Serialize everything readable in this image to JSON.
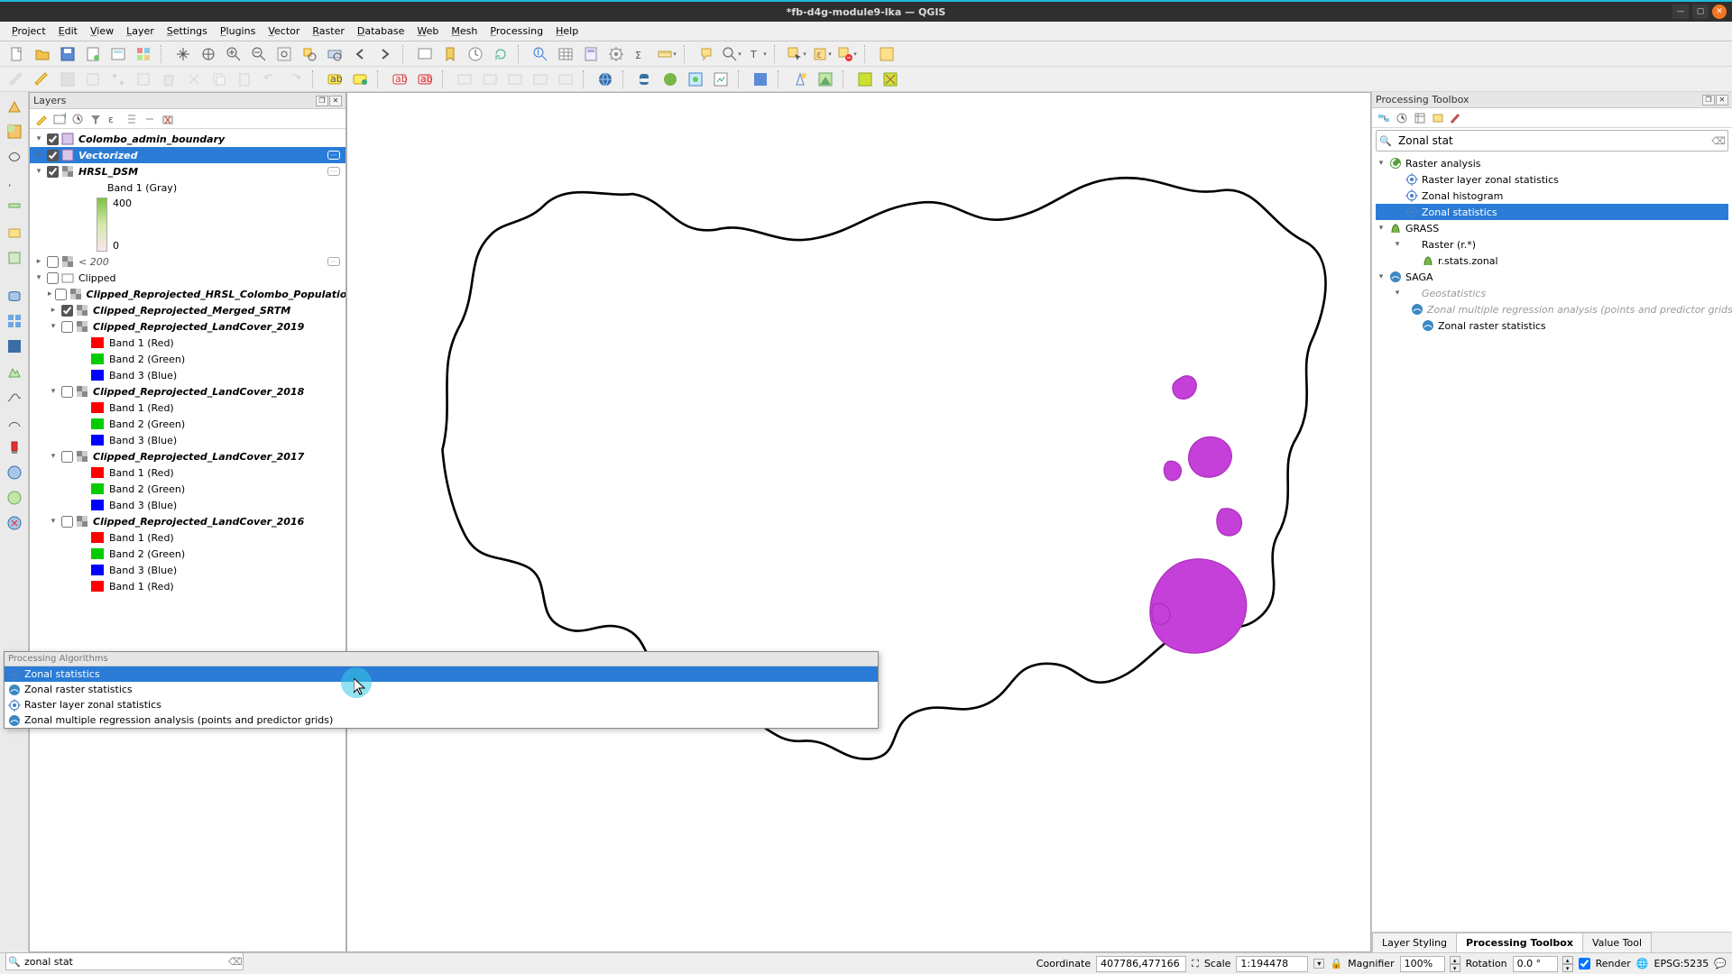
{
  "window": {
    "title": "*fb-d4g-module9-lka — QGIS"
  },
  "menus": [
    "Project",
    "Edit",
    "View",
    "Layer",
    "Settings",
    "Plugins",
    "Vector",
    "Raster",
    "Database",
    "Web",
    "Mesh",
    "Processing",
    "Help"
  ],
  "panels": {
    "layers_title": "Layers",
    "toolbox_title": "Processing Toolbox"
  },
  "layers": {
    "items": [
      {
        "name": "Colombo_admin_boundary",
        "style": "bi",
        "checked": true,
        "indent": 0,
        "exp": "▾",
        "icon": "poly"
      },
      {
        "name": "Vectorized",
        "style": "bi",
        "checked": true,
        "indent": 0,
        "exp": "▸",
        "icon": "poly",
        "selected": true
      },
      {
        "name": "HRSL_DSM",
        "style": "bi",
        "checked": true,
        "indent": 0,
        "exp": "▾",
        "icon": "raster"
      },
      {
        "name": "Band 1 (Gray)",
        "style": "",
        "indent": 2,
        "plain": true
      },
      {
        "name": "< 200",
        "style": "it",
        "checked": false,
        "indent": 0,
        "exp": "▸",
        "icon": "raster"
      },
      {
        "name": "Clipped",
        "style": "",
        "checked": false,
        "indent": 0,
        "exp": "▾",
        "icon": "group"
      },
      {
        "name": "Clipped_Reprojected_HRSL_Colombo_Population",
        "style": "bi",
        "checked": false,
        "indent": 1,
        "exp": "▸",
        "icon": "raster"
      },
      {
        "name": "Clipped_Reprojected_Merged_SRTM",
        "style": "bi",
        "checked": true,
        "indent": 1,
        "exp": "▸",
        "icon": "raster"
      },
      {
        "name": "Clipped_Reprojected_LandCover_2019",
        "style": "bi",
        "checked": false,
        "indent": 1,
        "exp": "▾",
        "icon": "raster"
      },
      {
        "name": "Clipped_Reprojected_LandCover_2018",
        "style": "bi",
        "checked": false,
        "indent": 1,
        "exp": "▾",
        "icon": "raster"
      },
      {
        "name": "Clipped_Reprojected_LandCover_2017",
        "style": "bi",
        "checked": false,
        "indent": 1,
        "exp": "▾",
        "icon": "raster"
      },
      {
        "name": "Clipped_Reprojected_LandCover_2016",
        "style": "bi",
        "checked": false,
        "indent": 1,
        "exp": "▾",
        "icon": "raster"
      }
    ],
    "gradient": {
      "max": "400",
      "min": "0"
    },
    "bands": {
      "r": "Band 1 (Red)",
      "g": "Band 2 (Green)",
      "b": "Band 3 (Blue)"
    }
  },
  "toolbox": {
    "search_value": "Zonal stat",
    "tree": [
      {
        "exp": "▾",
        "icon": "qgis",
        "label": "Raster analysis",
        "indent": 0
      },
      {
        "icon": "alg",
        "label": "Raster layer zonal statistics",
        "indent": 1
      },
      {
        "icon": "alg",
        "label": "Zonal histogram",
        "indent": 1
      },
      {
        "icon": "alg",
        "label": "Zonal statistics",
        "indent": 1,
        "selected": true
      },
      {
        "exp": "▾",
        "icon": "grass",
        "label": "GRASS",
        "indent": 0
      },
      {
        "exp": "▾",
        "label": "Raster (r.*)",
        "indent": 1
      },
      {
        "icon": "grass",
        "label": "r.stats.zonal",
        "indent": 2
      },
      {
        "exp": "▾",
        "icon": "saga",
        "label": "SAGA",
        "indent": 0
      },
      {
        "exp": "▾",
        "label": "Geostatistics",
        "indent": 1,
        "grey": true
      },
      {
        "icon": "saga",
        "label": "Zonal multiple regression analysis (points and predictor grids)",
        "indent": 2,
        "grey": true
      },
      {
        "icon": "saga",
        "label": "Zonal raster statistics",
        "indent": 2
      }
    ]
  },
  "tabs": {
    "t1": "Layer Styling",
    "t2": "Processing Toolbox",
    "t3": "Value Tool"
  },
  "locator": {
    "value": "zonal stat"
  },
  "popup": {
    "header": "Processing Algorithms",
    "items": [
      {
        "label": "Zonal statistics",
        "icon": "alg",
        "selected": true
      },
      {
        "label": "Zonal raster statistics",
        "icon": "saga"
      },
      {
        "label": "Raster layer zonal statistics",
        "icon": "alg"
      },
      {
        "label": "Zonal multiple regression analysis (points and predictor grids)",
        "icon": "saga"
      }
    ]
  },
  "status": {
    "coord_label": "Coordinate",
    "coord_value": "407786,477166",
    "scale_label": "Scale",
    "scale_value": "1:194478",
    "mag_label": "Magnifier",
    "mag_value": "100%",
    "rot_label": "Rotation",
    "rot_value": "0.0 °",
    "render": "Render",
    "crs": "EPSG:5235"
  }
}
